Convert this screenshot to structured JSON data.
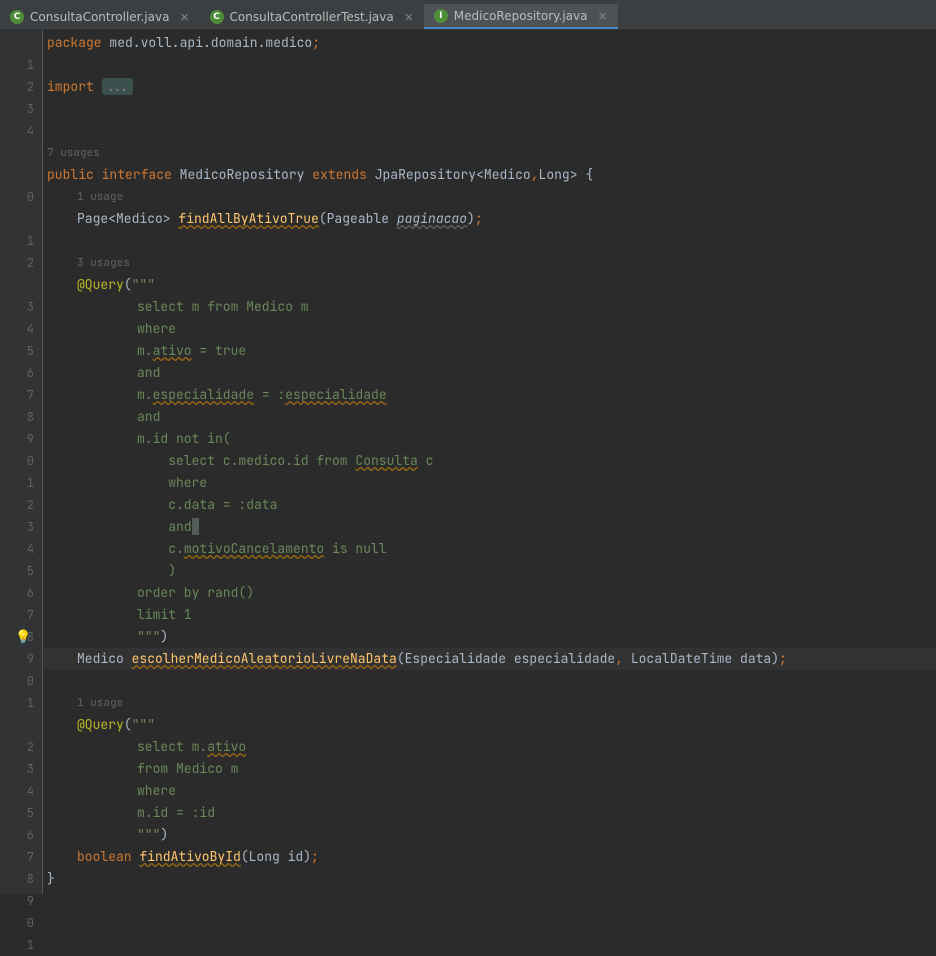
{
  "tabs": [
    {
      "label": "ConsultaController.java",
      "icon": "C"
    },
    {
      "label": "ConsultaControllerTest.java",
      "icon": "C"
    },
    {
      "label": "MedicoRepository.java",
      "icon": "I",
      "active": true
    }
  ],
  "gutter_rows": [
    "",
    "1",
    "2",
    "3",
    "4",
    "",
    "7 usages",
    "0",
    "",
    "1 usage",
    "1",
    "2",
    "",
    "3 usages",
    "3",
    "4",
    "5",
    "6",
    "7",
    "8",
    "9",
    "0",
    "1",
    "2",
    "3",
    "4",
    "5",
    "6",
    "7",
    "8",
    "9",
    "0",
    "1",
    "",
    "1 usage",
    "2",
    "3",
    "4",
    "5",
    "6",
    "7",
    "8",
    "9",
    "0",
    "1"
  ],
  "code": {
    "package_kw": "package",
    "package_val": " med.voll.api.domain.medico",
    "import_kw": "import",
    "import_fold": "...",
    "usages7": "7 usages",
    "declaration_prefix": "public interface ",
    "class_name": "MedicoRepository",
    "extends": " extends ",
    "jpa": "JpaRepository<Medico",
    "long": "Long> {",
    "usage1": "1 usage",
    "page": "Page<Medico> ",
    "findAllByAtivo": "findAllByAtivoTrue",
    "pageable_open": "(Pageable ",
    "paginacao": "paginacao",
    "close_paren": ")",
    "usages3": "3 usages",
    "query_anno": "@Query",
    "triple_open": "(\"\"\"",
    "q1": "select m from Medico m",
    "q2": "where",
    "q3a": "m.",
    "q3b": "ativo",
    "q3c": " = true",
    "q4": "and",
    "q5a": "m.",
    "q5b": "especialidade",
    "q5c": " = :",
    "q5d": "especialidade",
    "q6": "and",
    "q7": "m.id not in(",
    "q8a": "    select c.medico.id from ",
    "q8b": "Consulta",
    "q8c": " c",
    "q9": "    where",
    "q10": "    c.data = :data",
    "q11a": "    and",
    "q11b": " ",
    "q12a": "    c.",
    "q12b": "motivoCancelamento",
    "q12c": " is null",
    "q13": "    )",
    "q14": "order by rand()",
    "q15": "limit 1",
    "triple_close1": "\"\"\"",
    "triple_close2": ")",
    "medico_type": "Medico ",
    "escolher": "escolherMedicoAleatorioLivreNaData",
    "escolher_params": "(Especialidade especialidade",
    "comma": ", ",
    "ldt": "LocalDateTime data)",
    "usage1b": "1 usage",
    "qb1": "select m.",
    "qb1b": "ativo",
    "qb2": "from Medico m",
    "qb3": "where",
    "qb4": "m.id = :id",
    "bool": "boolean ",
    "findAtivo": "findAtivoById",
    "long_id": "(Long id)",
    "closebrace": "}"
  }
}
